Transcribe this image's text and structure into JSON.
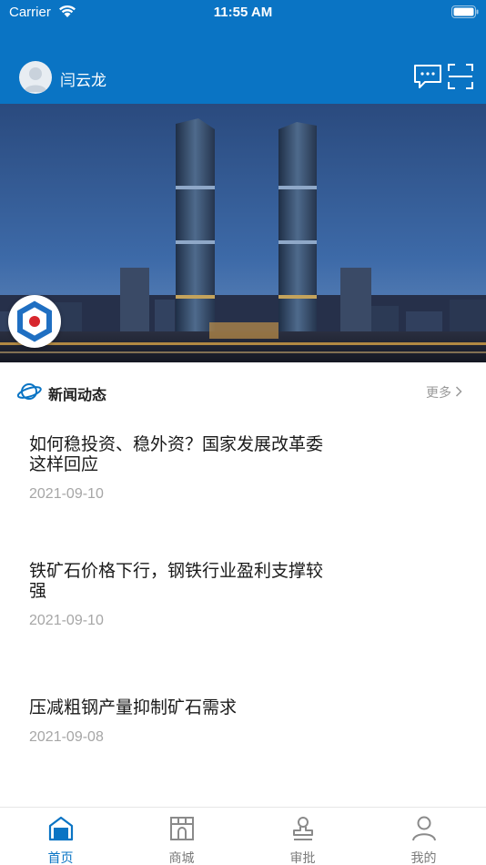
{
  "status_bar": {
    "carrier": "Carrier",
    "time": "11:55 AM"
  },
  "header": {
    "username": "闫云龙"
  },
  "icons": {
    "avatar": "avatar-icon",
    "message": "chat-bubble-icon",
    "scan": "scan-icon",
    "news": "planet-icon",
    "logo": "app-logo-icon"
  },
  "colors": {
    "brand": "#0a74c4",
    "muted": "#a6a6a6"
  },
  "news": {
    "title": "新闻动态",
    "more": "更多",
    "items": [
      {
        "title": "如何稳投资、稳外资？国家发展改革委这样回应",
        "date": "2021-09-10"
      },
      {
        "title": "铁矿石价格下行，钢铁行业盈利支撑较强",
        "date": "2021-09-10"
      },
      {
        "title": "压减粗钢产量抑制矿石需求",
        "date": "2021-09-08"
      }
    ]
  },
  "tabbar": {
    "tabs": [
      {
        "label": "首页",
        "icon": "home-icon",
        "active": true
      },
      {
        "label": "商城",
        "icon": "store-icon",
        "active": false
      },
      {
        "label": "审批",
        "icon": "stamp-icon",
        "active": false
      },
      {
        "label": "我的",
        "icon": "person-icon",
        "active": false
      }
    ]
  }
}
